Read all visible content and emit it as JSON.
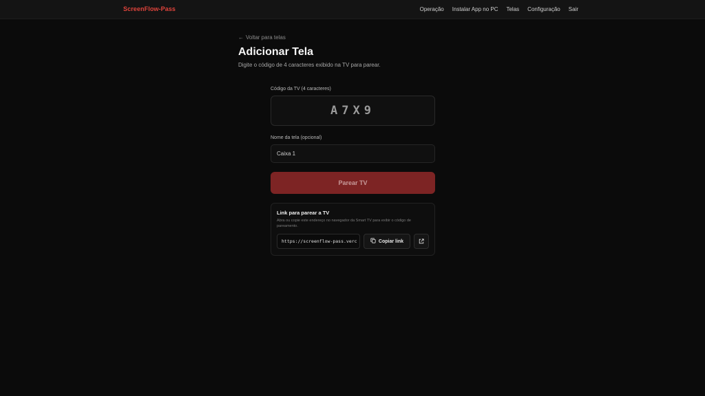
{
  "header": {
    "brand": "ScreenFlow-Pass",
    "nav": [
      "Operação",
      "Instalar App no PC",
      "Telas",
      "Configuração",
      "Sair"
    ]
  },
  "back_link": "Voltar para telas",
  "page_title": "Adicionar Tela",
  "subtitle": "Digite o código de 4 caracteres exibido na TV para parear.",
  "code_field": {
    "label": "Código da TV (4 caracteres)",
    "value": "A7X9"
  },
  "name_field": {
    "label": "Nome da tela (opcional)",
    "value": "Caixa 1"
  },
  "pair_button": "Parear TV",
  "link_card": {
    "title": "Link para parear a TV",
    "description": "Abra ou copie este endereço no navegador da Smart TV para exibir o código de pareamento.",
    "url": "https://screenflow-pass.verc",
    "copy_label": "Copiar link"
  },
  "colors": {
    "accent": "#e0443c",
    "button_bg": "#7d2424",
    "background": "#0b0b0b"
  }
}
